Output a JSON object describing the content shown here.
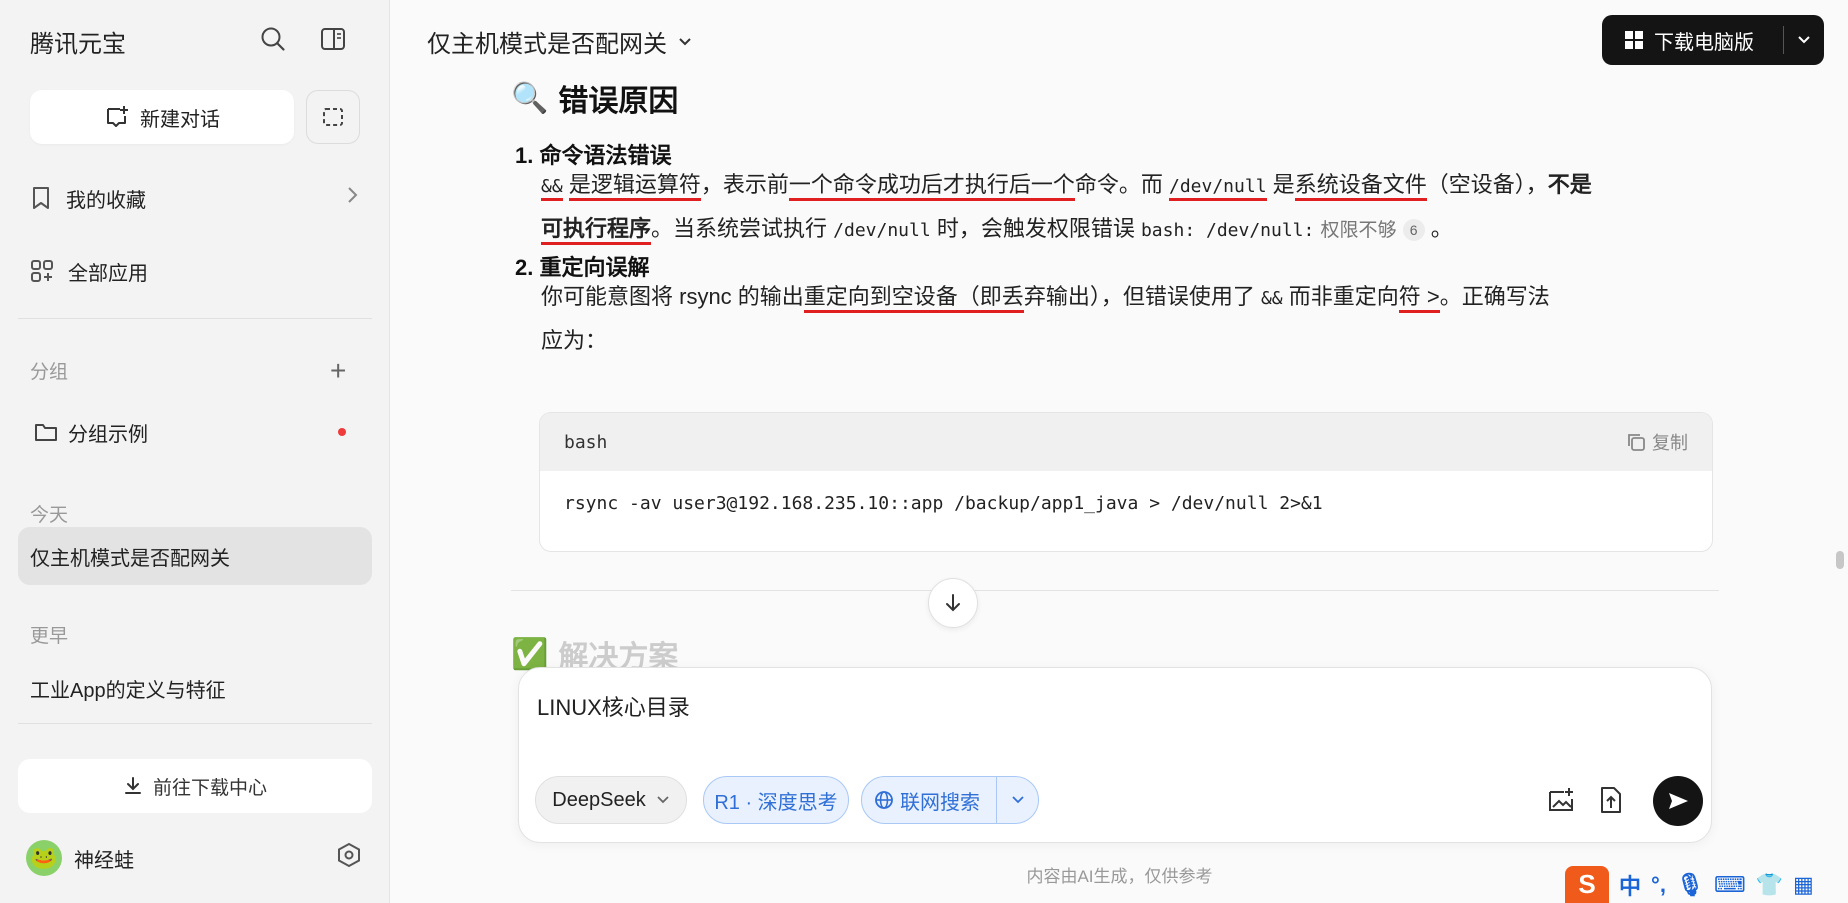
{
  "sidebar": {
    "brand": "腾讯元宝",
    "new_chat": "新建对话",
    "favorites": "我的收藏",
    "all_apps": "全部应用",
    "group_label": "分组",
    "group_example": "分组示例",
    "today_label": "今天",
    "today_items": [
      "仅主机模式是否配网关"
    ],
    "earlier_label": "更早",
    "earlier_items": [
      "工业App的定义与特征"
    ],
    "download_center": "前往下载中心",
    "user_name": "神经蛙"
  },
  "header": {
    "conversation_title": "仅主机模式是否配网关",
    "download_button": "下载电脑版"
  },
  "answer": {
    "section_title": "错误原因",
    "item1_title": "1. 命令语法错误",
    "item1_andand": "&&",
    "item1_t1": "是逻辑运算符",
    "item1_t2": "，表示前",
    "item1_t3": "一个命令成功后才执行后一个",
    "item1_t4": "命令。而",
    "item1_devnull": "/dev/null",
    "item1_t5": "是",
    "item1_t6": "系统设备文件",
    "item1_t7": "（空设备），",
    "item1_bold1": "不是",
    "item1_bold2": "可执行程序",
    "item1_t8": "。当系统尝试执行",
    "item1_devnull2": "/dev/null",
    "item1_t9": "时，会触发权限错误",
    "item1_err": "bash: /dev/null:",
    "item1_err_text": "权限不够",
    "item1_ref": "6",
    "item1_end": "。",
    "item2_title": "2. 重定向误解",
    "item2_t1": "你可能意图将 rsync 的输出",
    "item2_t2": "重定向到空设备（即丢",
    "item2_t3": "弃输出），但错误使用了",
    "item2_andand": "&&",
    "item2_t4": "而非重定向",
    "item2_t5": "符 >",
    "item2_t6": "。正确写法应为：",
    "code_lang": "bash",
    "copy_label": "复制",
    "code": "rsync -av user3@192.168.235.10::app /backup/app1_java > /dev/null 2>&1",
    "next_section": "解决方案"
  },
  "composer": {
    "text": "LINUX核心目录",
    "model": "DeepSeek",
    "think": "R1 · 深度思考",
    "search": "联网搜索"
  },
  "footer_note": "内容由AI生成，仅供参考",
  "ime": {
    "lang": "中"
  }
}
